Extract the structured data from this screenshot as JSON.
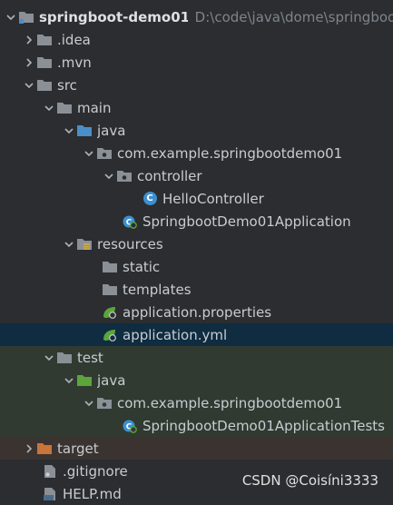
{
  "project": {
    "name": "springboot-demo01",
    "path": "D:\\code\\java\\dome\\springboo"
  },
  "items": {
    "idea": ".idea",
    "mvn": ".mvn",
    "src": "src",
    "main": "main",
    "java": "java",
    "package": "com.example.springbootdemo01",
    "controller": "controller",
    "hello_controller": "HelloController",
    "app_class": "SpringbootDemo01Application",
    "resources": "resources",
    "static": "static",
    "templates": "templates",
    "app_properties": "application.properties",
    "app_yml": "application.yml",
    "test": "test",
    "test_java": "java",
    "test_package": "com.example.springbootdemo01",
    "test_class": "SpringbootDemo01ApplicationTests",
    "target": "target",
    "gitignore": ".gitignore",
    "help": "HELP.md"
  },
  "watermark": "CSDN @Coisíni3333",
  "colors": {
    "background": "#2b2d30",
    "selected": "#0f2c40",
    "test_bg": "#313a31",
    "target_bg": "#3a3330",
    "folder": "#8b9097",
    "source_folder": "#4a8fc8",
    "test_folder": "#5ca53a",
    "excluded_folder": "#c8753a"
  }
}
